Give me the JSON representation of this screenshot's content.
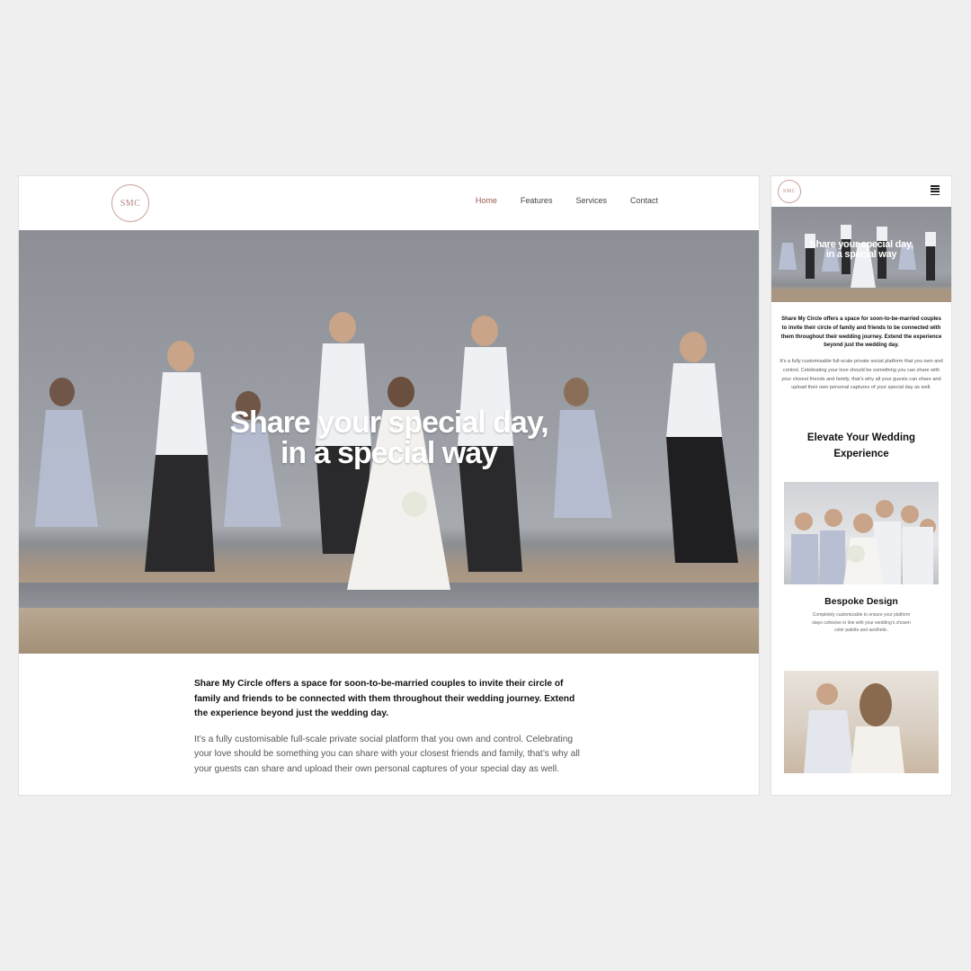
{
  "site": {
    "logo_text": "SMC",
    "nav": [
      {
        "label": "Home",
        "active": true
      },
      {
        "label": "Features",
        "active": false
      },
      {
        "label": "Services",
        "active": false
      },
      {
        "label": "Contact",
        "active": false
      }
    ]
  },
  "hero": {
    "title_line1": "Share your special day,",
    "title_line2": "in a special way"
  },
  "intro": {
    "lead": "Share My Circle offers a space for soon-to-be-married couples to invite their circle of family and friends to be connected with them throughout their wedding journey. Extend the experience beyond just the wedding day.",
    "body": "It’s a fully customisable full-scale private social platform that you own and control. Celebrating your love should be something you can share with your closest friends and family, that’s why all your guests can share and upload their own personal captures of your special day as well."
  },
  "mobile": {
    "section_title": "Elevate Your Wedding Experience",
    "card1": {
      "title": "Bespoke Design",
      "text": "Completely customizable to ensure your platform stays cohesive in line with your wedding’s chosen color palette and aesthetic."
    }
  },
  "colors": {
    "accent": "#9b5a52",
    "logo_ring": "#c9a39c",
    "background": "#efefef"
  },
  "icons": [
    "menu-icon"
  ]
}
